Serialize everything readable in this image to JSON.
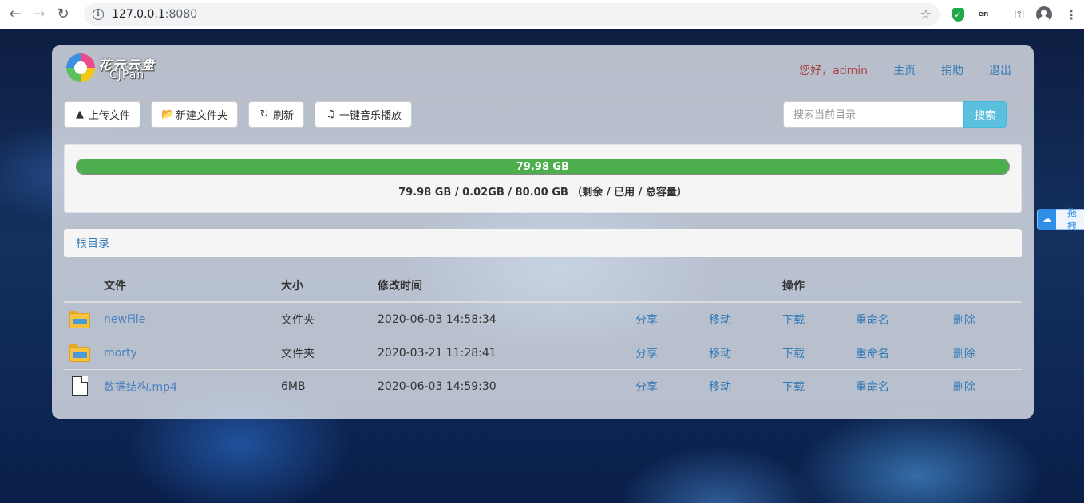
{
  "browser": {
    "url_host": "127.0.0.1",
    "url_port": ":8080"
  },
  "logo": {
    "text_cn": "花云云盘",
    "text_en": "CJPan"
  },
  "nav": {
    "greeting": "您好，admin",
    "home": "主页",
    "donate": "捐助",
    "logout": "退出"
  },
  "toolbar": {
    "upload": "上传文件",
    "new_folder": "新建文件夹",
    "refresh": "刷新",
    "music": "一键音乐播放"
  },
  "search": {
    "placeholder": "搜索当前目录",
    "button": "搜索"
  },
  "storage": {
    "bar_label": "79.98 GB",
    "bar_percent": 99.98,
    "summary": "79.98 GB / 0.02GB / 80.00 GB （剩余 / 已用 / 总容量）"
  },
  "breadcrumb": {
    "root": "根目录"
  },
  "table": {
    "headers": {
      "name": "文件",
      "size": "大小",
      "modified": "修改时间",
      "actions": "操作"
    },
    "action_labels": {
      "share": "分享",
      "move": "移动",
      "download": "下载",
      "rename": "重命名",
      "delete": "删除"
    },
    "rows": [
      {
        "icon": "folder-icon",
        "name": "newFile",
        "size": "文件夹",
        "modified": "2020-06-03 14:58:34"
      },
      {
        "icon": "folder-icon",
        "name": "morty",
        "size": "文件夹",
        "modified": "2020-03-21 11:28:41"
      },
      {
        "icon": "file-icon",
        "name": "数据结构.mp4",
        "size": "6MB",
        "modified": "2020-06-03 14:59:30"
      }
    ]
  },
  "side_widget": {
    "label": "拖拽"
  },
  "colors": {
    "link": "#337ab7",
    "greeting": "#a94442",
    "progress": "#4cae4c",
    "search_button": "#5bc0de"
  }
}
